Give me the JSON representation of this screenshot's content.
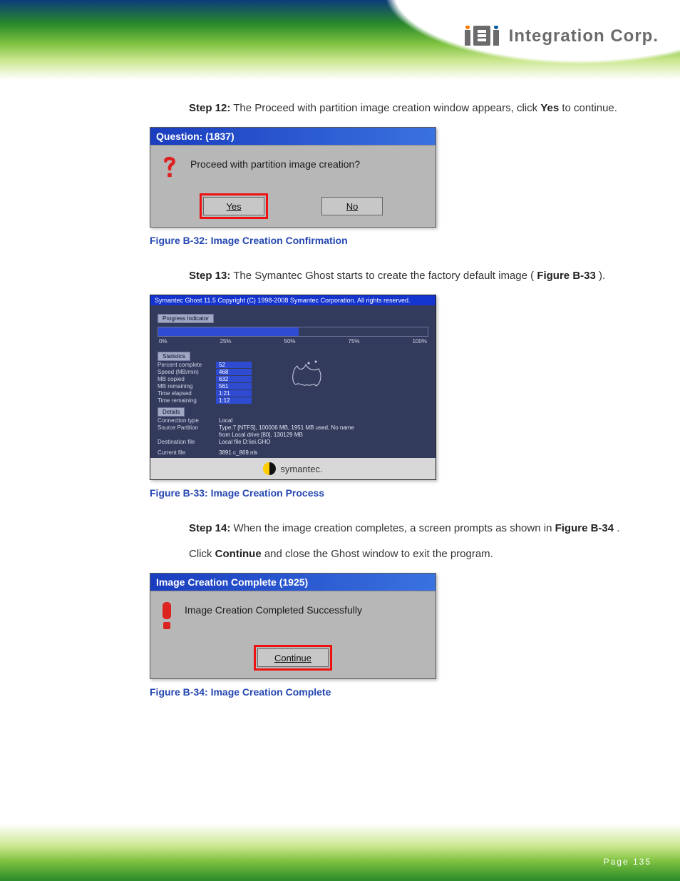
{
  "header": {
    "logo_text": "Integration Corp."
  },
  "step12": {
    "text_a": "The Proceed with partition image creation window appears, click",
    "bold": "Yes",
    "text_b": "to continue."
  },
  "dlg_q": {
    "title": "Question: (1837)",
    "msg": "Proceed with partition image creation?",
    "yes": "Yes",
    "no": "No"
  },
  "fig32": {
    "cap": "Figure B-32: Image Creation Confirmation"
  },
  "step13": {
    "text_a": "The Symantec Ghost starts to create the factory default image (",
    "ref": "Figure B-33",
    "text_b": ")."
  },
  "ghost": {
    "title": "Symantec Ghost 11.5   Copyright (C) 1998-2008 Symantec Corporation. All rights reserved.",
    "prog_label": "Progress Indicator",
    "ticks": {
      "t0": "0%",
      "t25": "25%",
      "t50": "50%",
      "t75": "75%",
      "t100": "100%"
    },
    "stats_label": "Statistics",
    "stats": {
      "pct_k": "Percent complete",
      "pct_v": "52",
      "spd_k": "Speed (MB/min)",
      "spd_v": "468",
      "cp_k": "MB copied",
      "cp_v": "632",
      "rm_k": "MB remaining",
      "rm_v": "561",
      "te_k": "Time elapsed",
      "te_v": "1:21",
      "tr_k": "Time remaining",
      "tr_v": "1:12"
    },
    "details_label": "Details",
    "details": {
      "ct_k": "Connection type",
      "ct_v": "Local",
      "sp_k": "Source Partition",
      "sp_v": "Type:7 [NTFS], 100006 MB, 1951 MB used, No name",
      "sp2_v": "from Local drive [80], 130129 MB",
      "df_k": "Destination file",
      "df_v": "Local file D:\\iei.GHO",
      "cf_k": "Current file",
      "cf_v": "3891 c_869.nls"
    },
    "footer": "symantec."
  },
  "fig33": {
    "cap": "Figure B-33: Image Creation Process"
  },
  "step14": {
    "text_a": "When the image creation completes, a screen prompts as shown in",
    "ref": "Figure B-34",
    "text_b": ".",
    "text2a": "Click",
    "bold": "Continue",
    "text2b": "and close the Ghost window to exit the program."
  },
  "dlg_c": {
    "title": "Image Creation Complete (1925)",
    "msg": "Image Creation Completed Successfully",
    "btn": "Continue"
  },
  "fig34": {
    "cap": "Figure B-34: Image Creation Complete"
  },
  "page": {
    "cap": "Page 135"
  }
}
